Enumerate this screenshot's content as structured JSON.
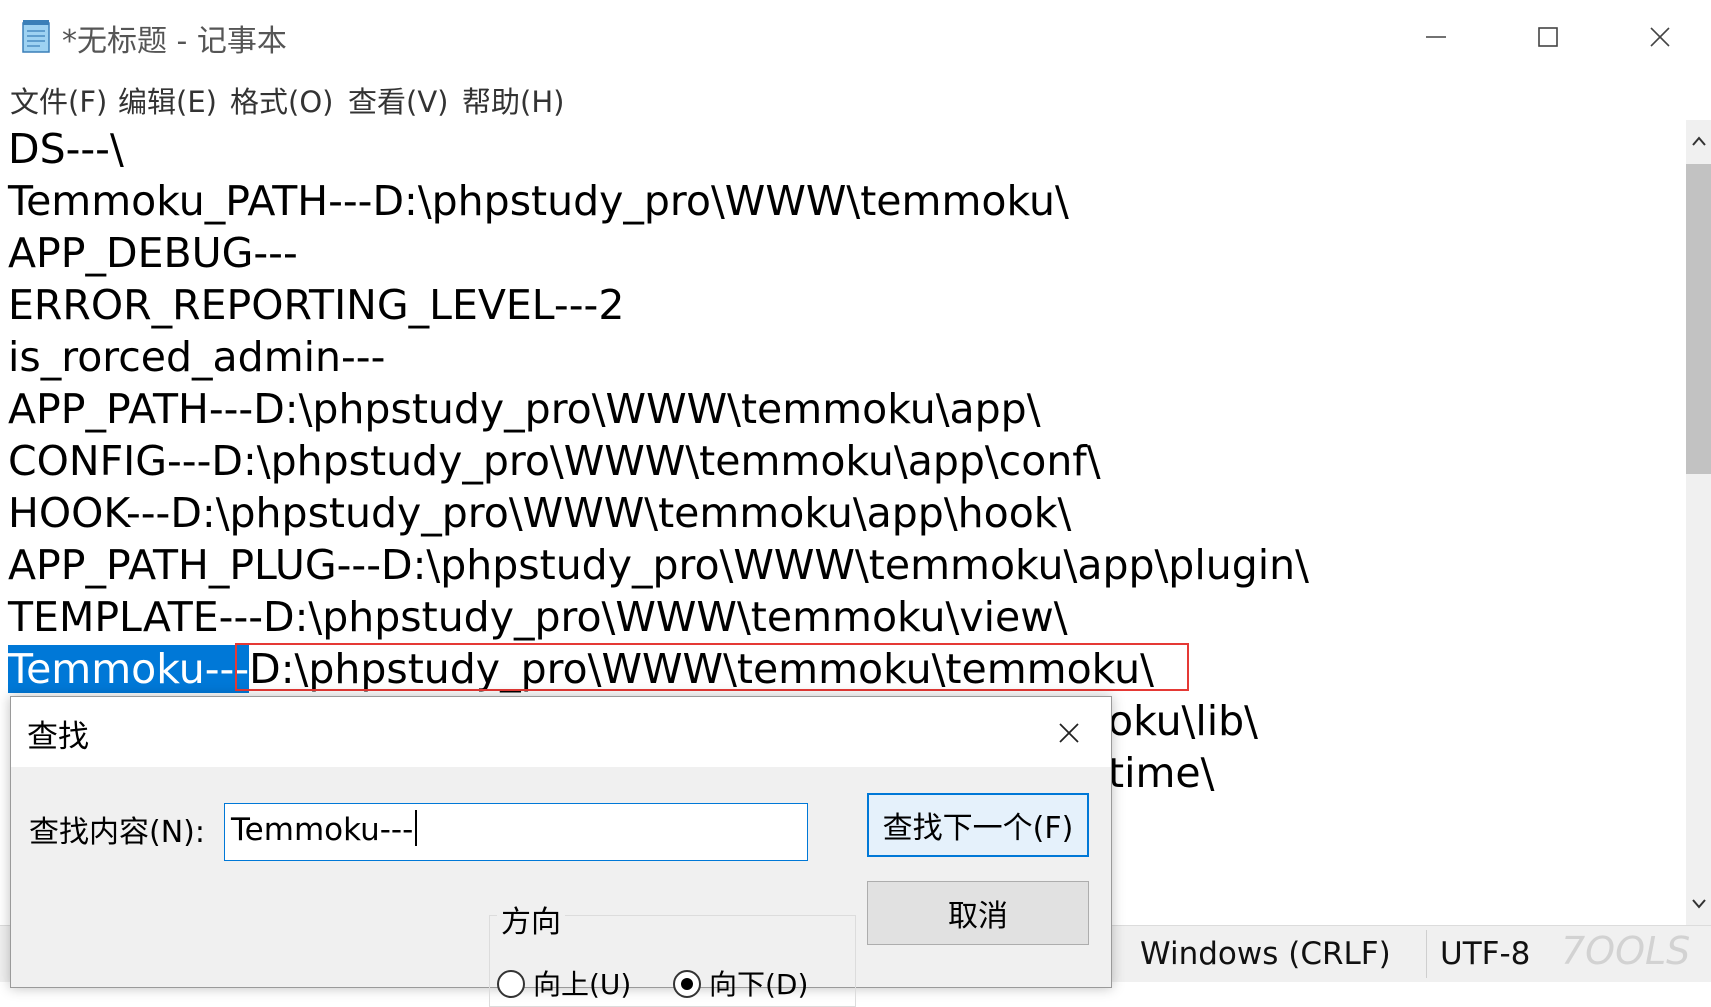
{
  "window": {
    "title": "*无标题 - 记事本",
    "app_icon": "notepad-icon",
    "controls": [
      "minimize-icon",
      "maximize-icon",
      "close-icon"
    ]
  },
  "menu": [
    "文件(F)",
    "编辑(E)",
    "格式(O)",
    "查看(V)",
    "帮助(H)"
  ],
  "editor": {
    "lines": [
      "DS---\\",
      "Temmoku_PATH---D:\\phpstudy_pro\\WWW\\temmoku\\",
      "APP_DEBUG---",
      "ERROR_REPORTING_LEVEL---2",
      "is_rorced_admin---",
      "APP_PATH---D:\\phpstudy_pro\\WWW\\temmoku\\app\\",
      "CONFIG---D:\\phpstudy_pro\\WWW\\temmoku\\app\\conf\\",
      "HOOK---D:\\phpstudy_pro\\WWW\\temmoku\\app\\hook\\",
      "APP_PATH_PLUG---D:\\phpstudy_pro\\WWW\\temmoku\\app\\plugin\\",
      "TEMPLATE---D:\\phpstudy_pro\\WWW\\temmoku\\view\\"
    ],
    "selected_line": {
      "selected_text": "Temmoku---",
      "rest_text": "D:\\phpstudy_pro\\WWW\\temmoku\\temmoku\\"
    },
    "partial_lines": [
      "oku\\lib\\",
      "time\\"
    ],
    "highlight_color": "#0078d7",
    "annotation_color": "#e53935"
  },
  "statusbar": {
    "line_ending": "Windows (CRLF)",
    "encoding": "UTF-8",
    "watermark": "7OOLS"
  },
  "find_dialog": {
    "title": "查找",
    "label": "查找内容(N):",
    "value": "Temmoku---",
    "find_next": "查找下一个(F)",
    "cancel": "取消",
    "direction_title": "方向",
    "direction_up": "向上(U)",
    "direction_down": "向下(D)",
    "selected_direction": "down"
  }
}
